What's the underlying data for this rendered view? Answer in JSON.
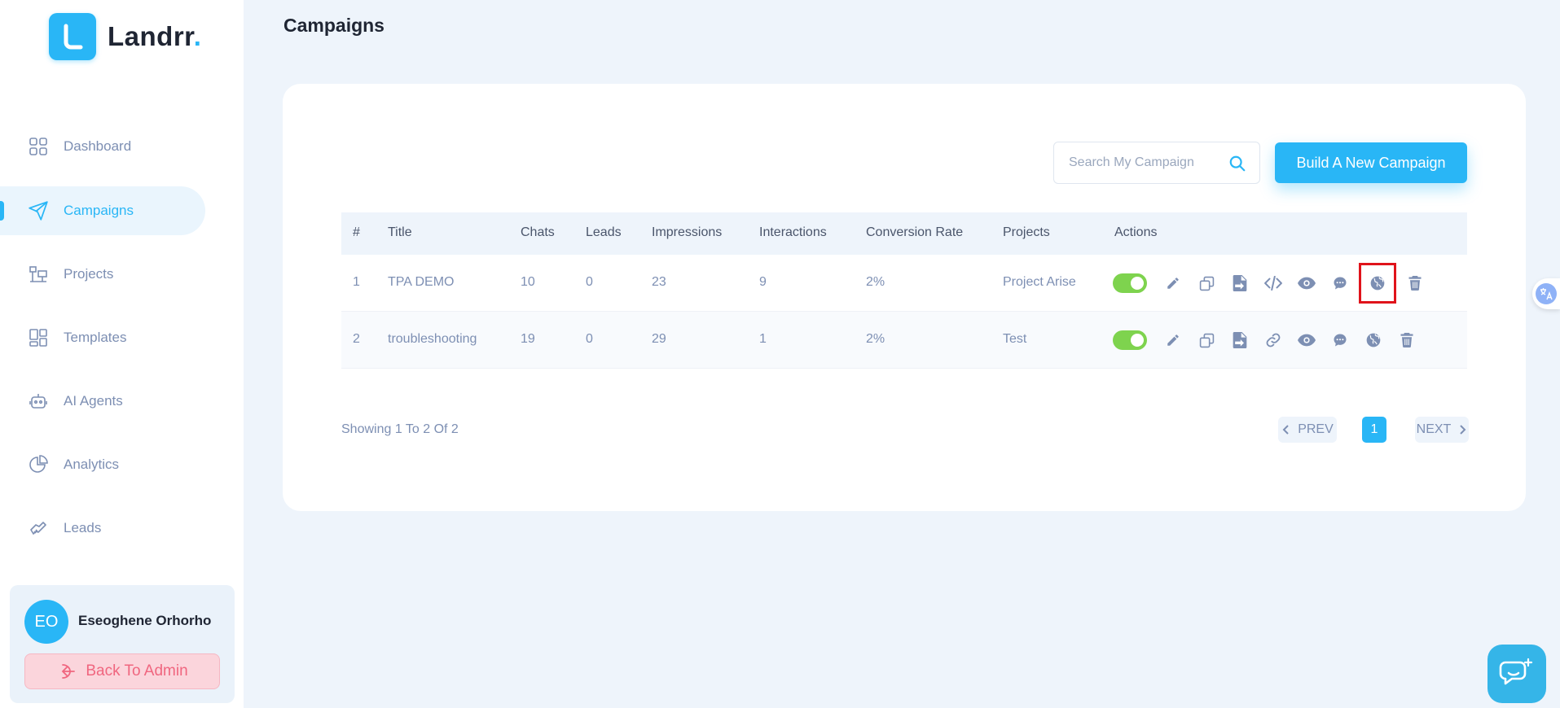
{
  "app": {
    "name": "Landrr",
    "name_dot": "."
  },
  "sidebar": {
    "items": [
      {
        "label": "Dashboard",
        "icon": "grid-icon"
      },
      {
        "label": "Campaigns",
        "icon": "send-icon",
        "active": true
      },
      {
        "label": "Projects",
        "icon": "projects-icon"
      },
      {
        "label": "Templates",
        "icon": "templates-icon"
      },
      {
        "label": "AI Agents",
        "icon": "robot-icon"
      },
      {
        "label": "Analytics",
        "icon": "pie-chart-icon"
      },
      {
        "label": "Leads",
        "icon": "handshake-icon"
      }
    ],
    "user": {
      "initials": "EO",
      "name": "Eseoghene Orhorho",
      "back_label": "Back To Admin"
    }
  },
  "header": {
    "title": "Campaigns"
  },
  "search": {
    "placeholder": "Search My Campaign",
    "value": ""
  },
  "build_button": "Build A New Campaign",
  "table": {
    "columns": [
      "#",
      "Title",
      "Chats",
      "Leads",
      "Impressions",
      "Interactions",
      "Conversion Rate",
      "Projects",
      "Actions"
    ],
    "rows": [
      {
        "num": "1",
        "title": "TPA DEMO",
        "chats": "10",
        "leads": "0",
        "impressions": "23",
        "interactions": "9",
        "conversion": "2%",
        "project": "Project Arise",
        "enabled": true
      },
      {
        "num": "2",
        "title": "troubleshooting",
        "chats": "19",
        "leads": "0",
        "impressions": "29",
        "interactions": "1",
        "conversion": "2%",
        "project": "Test",
        "enabled": true
      }
    ]
  },
  "pagination": {
    "summary": "Showing 1 To 2 Of 2",
    "prev": "PREV",
    "current": "1",
    "next": "NEXT"
  },
  "colors": {
    "accent": "#29b6f6",
    "toggle_on": "#7ed34e",
    "danger": "#f0667f",
    "highlight": "#e0131b"
  }
}
